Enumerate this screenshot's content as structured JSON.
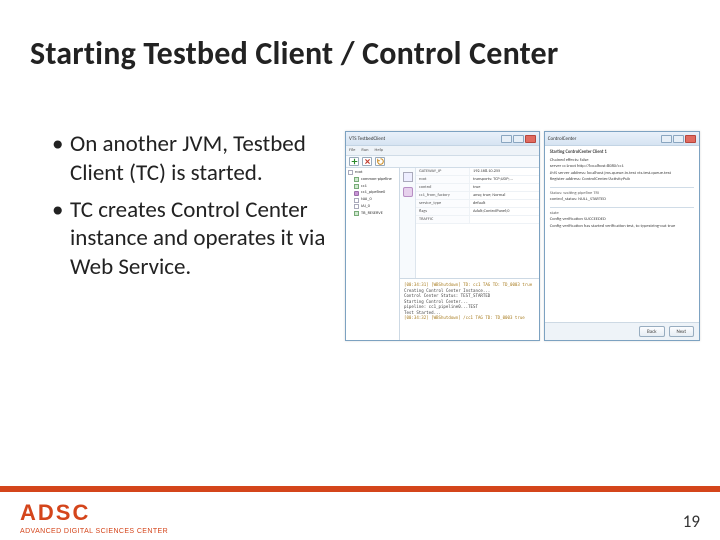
{
  "title": "Starting Testbed Client / Control Center",
  "bullets": [
    "On another JVM, Testbed Client (TC) is started.",
    "TC creates Control Center instance and operates it via Web Service."
  ],
  "footer": {
    "acronym": "ADSC",
    "org": "ADVANCED DIGITAL SCIENCES CENTER",
    "page": "19"
  },
  "tc": {
    "title": "VTS TestbedClient",
    "menu": [
      "File",
      "Run",
      "Help"
    ],
    "tree": {
      "root": "root",
      "items": [
        "common-pipeline",
        "cc1",
        "cc1_pipeline0",
        "NAI_0",
        "IAI_0",
        "TB_RESERVE"
      ]
    },
    "props": [
      {
        "k": "GATEWAY_IP",
        "v": "192.168.10.255"
      },
      {
        "k": "root",
        "v": "transports: TCP;UDP;..."
      },
      {
        "k": "control",
        "v": "true"
      },
      {
        "k": "cc1_from_factory",
        "v": "amq; true; Normal"
      },
      {
        "k": "service_type",
        "v": "default"
      },
      {
        "k": "flags",
        "v": "Adult;ControlPanel;0"
      },
      {
        "k": "TRAFFIC",
        "v": ""
      }
    ],
    "console": [
      "[00:34:31] [WBShutdown] TD: cc1 TAG TD: TD_0003 true",
      "",
      "Creating Control Center Instance...",
      "Control Center Status: TEST_STARTED",
      "Starting Control Center...",
      "pipeline: cc1_pipeline0...TEST",
      "",
      "Test Started...",
      "[00:34:32] [WBShutdown] /cc1 TAG TD: TD_0003 true"
    ]
  },
  "cc": {
    "title": "ControlCenter",
    "header": "Starting ControlCenter Client 1",
    "lines": [
      "Chained effects: false",
      "server cc1root http://localhost:8080/cc1",
      "JMS server address: localhost jms.queue.in.test vts.test.queue.test",
      "Register address: ControlCenter/ActivityPub"
    ],
    "status_label": "Status: waiting pipeline TRI",
    "status_val": "control_status: NULL_STARTED",
    "state_label": "state",
    "state_val": "Config verification SUCCEEDED",
    "msg": "Config verification has started verification test, to typestring-out true",
    "back": "Back",
    "next": "Next"
  }
}
